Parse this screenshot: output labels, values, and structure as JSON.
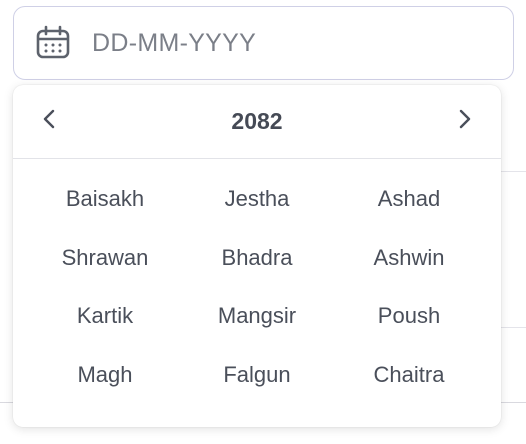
{
  "date_input": {
    "icon": "calendar-icon",
    "placeholder": "DD-MM-YYYY"
  },
  "picker": {
    "prev_icon": "chevron-left-icon",
    "next_icon": "chevron-right-icon",
    "year": "2082",
    "months": [
      "Baisakh",
      "Jestha",
      "Ashad",
      "Shrawan",
      "Bhadra",
      "Ashwin",
      "Kartik",
      "Mangsir",
      "Poush",
      "Magh",
      "Falgun",
      "Chaitra"
    ]
  },
  "colors": {
    "input_border": "#cfd0e6",
    "text": "#4a4f5a",
    "placeholder": "#7b7f88"
  }
}
